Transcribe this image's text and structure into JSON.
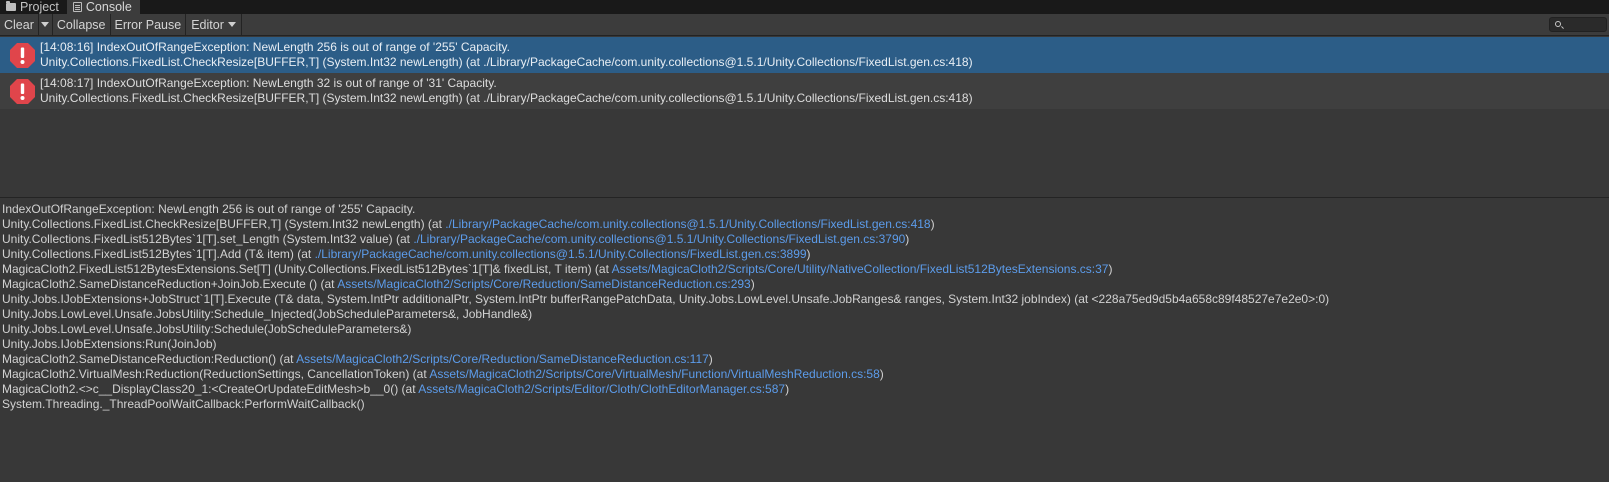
{
  "tabs": [
    {
      "label": "Project",
      "icon": "folder-icon"
    },
    {
      "label": "Console",
      "icon": "console-icon"
    }
  ],
  "toolbar": {
    "clear": "Clear",
    "collapse": "Collapse",
    "error_pause": "Error Pause",
    "editor": "Editor",
    "search_placeholder": ""
  },
  "colors": {
    "selected_row": "#2c5d87",
    "error_icon": "#e0454b",
    "link": "#5c9ceb",
    "background": "#383838"
  },
  "logs": [
    {
      "line1": "[14:08:16] IndexOutOfRangeException: NewLength 256 is out of range of '255' Capacity.",
      "line2": "Unity.Collections.FixedList.CheckResize[BUFFER,T] (System.Int32 newLength) (at ./Library/PackageCache/com.unity.collections@1.5.1/Unity.Collections/FixedList.gen.cs:418)",
      "icon": "error-icon"
    },
    {
      "line1": "[14:08:17] IndexOutOfRangeException: NewLength 32 is out of range of '31' Capacity.",
      "line2": "Unity.Collections.FixedList.CheckResize[BUFFER,T] (System.Int32 newLength) (at ./Library/PackageCache/com.unity.collections@1.5.1/Unity.Collections/FixedList.gen.cs:418)",
      "icon": "error-icon"
    }
  ],
  "detail": {
    "message": "IndexOutOfRangeException: NewLength 256 is out of range of '255' Capacity.",
    "stack": [
      {
        "text": "Unity.Collections.FixedList.CheckResize[BUFFER,T] (System.Int32 newLength) (at ",
        "link": "./Library/PackageCache/com.unity.collections@1.5.1/Unity.Collections/FixedList.gen.cs:418",
        "end": ")"
      },
      {
        "text": "Unity.Collections.FixedList512Bytes`1[T].set_Length (System.Int32 value) (at ",
        "link": "./Library/PackageCache/com.unity.collections@1.5.1/Unity.Collections/FixedList.gen.cs:3790",
        "end": ")"
      },
      {
        "text": "Unity.Collections.FixedList512Bytes`1[T].Add (T& item) (at ",
        "link": "./Library/PackageCache/com.unity.collections@1.5.1/Unity.Collections/FixedList.gen.cs:3899",
        "end": ")"
      },
      {
        "text": "MagicaCloth2.FixedList512BytesExtensions.Set[T] (Unity.Collections.FixedList512Bytes`1[T]& fixedList, T item) (at ",
        "link": "Assets/MagicaCloth2/Scripts/Core/Utility/NativeCollection/FixedList512BytesExtensions.cs:37",
        "end": ")"
      },
      {
        "text": "MagicaCloth2.SameDistanceReduction+JoinJob.Execute () (at ",
        "link": "Assets/MagicaCloth2/Scripts/Core/Reduction/SameDistanceReduction.cs:293",
        "end": ")"
      },
      {
        "text": "Unity.Jobs.IJobExtensions+JobStruct`1[T].Execute (T& data, System.IntPtr additionalPtr, System.IntPtr bufferRangePatchData, Unity.Jobs.LowLevel.Unsafe.JobRanges& ranges, System.Int32 jobIndex) (at <228a75ed9d5b4a658c89f48527e7e2e0>:0)",
        "link": "",
        "end": ""
      },
      {
        "text": "Unity.Jobs.LowLevel.Unsafe.JobsUtility:Schedule_Injected(JobScheduleParameters&, JobHandle&)",
        "link": "",
        "end": ""
      },
      {
        "text": "Unity.Jobs.LowLevel.Unsafe.JobsUtility:Schedule(JobScheduleParameters&)",
        "link": "",
        "end": ""
      },
      {
        "text": "Unity.Jobs.IJobExtensions:Run(JoinJob)",
        "link": "",
        "end": ""
      },
      {
        "text": "MagicaCloth2.SameDistanceReduction:Reduction() (at ",
        "link": "Assets/MagicaCloth2/Scripts/Core/Reduction/SameDistanceReduction.cs:117",
        "end": ")"
      },
      {
        "text": "MagicaCloth2.VirtualMesh:Reduction(ReductionSettings, CancellationToken) (at ",
        "link": "Assets/MagicaCloth2/Scripts/Core/VirtualMesh/Function/VirtualMeshReduction.cs:58",
        "end": ")"
      },
      {
        "text": "MagicaCloth2.<>c__DisplayClass20_1:<CreateOrUpdateEditMesh>b__0() (at ",
        "link": "Assets/MagicaCloth2/Scripts/Editor/Cloth/ClothEditorManager.cs:587",
        "end": ")"
      },
      {
        "text": "System.Threading._ThreadPoolWaitCallback:PerformWaitCallback()",
        "link": "",
        "end": ""
      }
    ]
  }
}
